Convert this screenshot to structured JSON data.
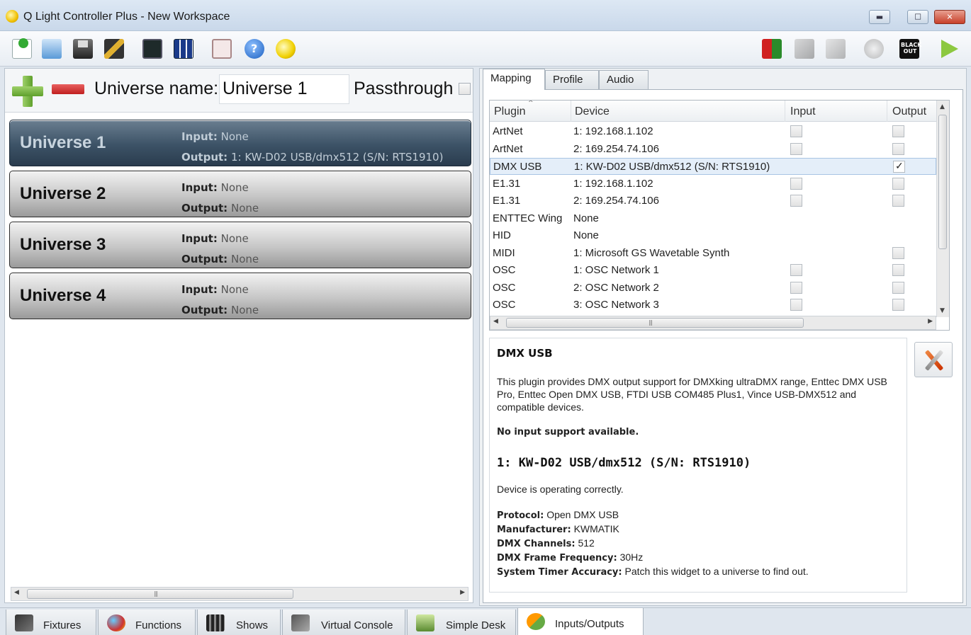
{
  "window": {
    "title": "Q Light Controller Plus - New Workspace",
    "controls": [
      "minimize",
      "maximize",
      "close"
    ]
  },
  "toolbar": {
    "left_icons": [
      "new-workspace-icon",
      "open-workspace-icon",
      "save-workspace-icon",
      "address-tool-icon",
      "dmx-dump-icon",
      "monitor-icon",
      "fullscreen-icon",
      "help-icon",
      "about-icon"
    ],
    "right_icons": [
      "live-edit-icon",
      "monitor-off-icon",
      "design-mode-icon",
      "stop-all-icon",
      "blackout-icon",
      "operate-mode-icon"
    ],
    "blackout_text": "BLACK OUT"
  },
  "universes_panel": {
    "name_label": "Universe name:",
    "name_value": "Universe 1",
    "passthrough_label": "Passthrough",
    "input_label": "Input:",
    "output_label": "Output:",
    "universes": [
      {
        "name": "Universe 1",
        "input": "None",
        "output": "1: KW-D02 USB/dmx512 (S/N: RTS1910)",
        "selected": true
      },
      {
        "name": "Universe 2",
        "input": "None",
        "output": "None",
        "selected": false
      },
      {
        "name": "Universe 3",
        "input": "None",
        "output": "None",
        "selected": false
      },
      {
        "name": "Universe 4",
        "input": "None",
        "output": "None",
        "selected": false
      }
    ]
  },
  "tabs": [
    {
      "label": "Mapping",
      "active": true
    },
    {
      "label": "Profile",
      "active": false
    },
    {
      "label": "Audio",
      "active": false
    }
  ],
  "mapping_table": {
    "columns": [
      "Plugin",
      "Device",
      "Input",
      "Output"
    ],
    "rows": [
      {
        "plugin": "ArtNet",
        "device": "1: 192.168.1.102",
        "input": false,
        "output": false,
        "has_input": true,
        "has_output": true
      },
      {
        "plugin": "ArtNet",
        "device": "2: 169.254.74.106",
        "input": false,
        "output": false,
        "has_input": true,
        "has_output": true
      },
      {
        "plugin": "DMX USB",
        "device": "1: KW-D02 USB/dmx512 (S/N: RTS1910)",
        "input": false,
        "output": true,
        "has_input": false,
        "has_output": true,
        "selected": true
      },
      {
        "plugin": "E1.31",
        "device": "1: 192.168.1.102",
        "input": false,
        "output": false,
        "has_input": true,
        "has_output": true
      },
      {
        "plugin": "E1.31",
        "device": "2: 169.254.74.106",
        "input": false,
        "output": false,
        "has_input": true,
        "has_output": true
      },
      {
        "plugin": "ENTTEC Wing",
        "device": "None",
        "has_input": false,
        "has_output": false
      },
      {
        "plugin": "HID",
        "device": "None",
        "has_input": false,
        "has_output": false
      },
      {
        "plugin": "MIDI",
        "device": "1: Microsoft GS Wavetable Synth",
        "input": false,
        "output": false,
        "has_input": false,
        "has_output": true
      },
      {
        "plugin": "OSC",
        "device": "1: OSC Network 1",
        "input": false,
        "output": false,
        "has_input": true,
        "has_output": true
      },
      {
        "plugin": "OSC",
        "device": "2: OSC Network 2",
        "input": false,
        "output": false,
        "has_input": true,
        "has_output": true
      },
      {
        "plugin": "OSC",
        "device": "3: OSC Network 3",
        "input": false,
        "output": false,
        "has_input": true,
        "has_output": true
      }
    ]
  },
  "plugin_info": {
    "title": "DMX USB",
    "description": "This plugin provides DMX output support for DMXking ultraDMX range, Enttec DMX USB Pro, Enttec Open DMX USB, FTDI USB COM485 Plus1, Vince USB-DMX512 and compatible devices.",
    "input_support": "No input support available.",
    "device_title": "1: KW-D02 USB/dmx512 (S/N: RTS1910)",
    "device_status": "Device is operating correctly.",
    "properties": [
      {
        "key": "Protocol:",
        "value": "Open DMX USB"
      },
      {
        "key": "Manufacturer:",
        "value": "KWMATIK"
      },
      {
        "key": "DMX Channels:",
        "value": "512"
      },
      {
        "key": "DMX Frame Frequency:",
        "value": "30Hz"
      },
      {
        "key": "System Timer Accuracy:",
        "value": "Patch this widget to a universe to find out."
      }
    ]
  },
  "bottom_tabs": [
    {
      "label": "Fixtures",
      "icon": "fixtures-icon",
      "active": false
    },
    {
      "label": "Functions",
      "icon": "functions-icon",
      "active": false
    },
    {
      "label": "Shows",
      "icon": "shows-icon",
      "active": false
    },
    {
      "label": "Virtual Console",
      "icon": "virtual-console-icon",
      "active": false
    },
    {
      "label": "Simple Desk",
      "icon": "simple-desk-icon",
      "active": false
    },
    {
      "label": "Inputs/Outputs",
      "icon": "inputs-outputs-icon",
      "active": true
    }
  ]
}
